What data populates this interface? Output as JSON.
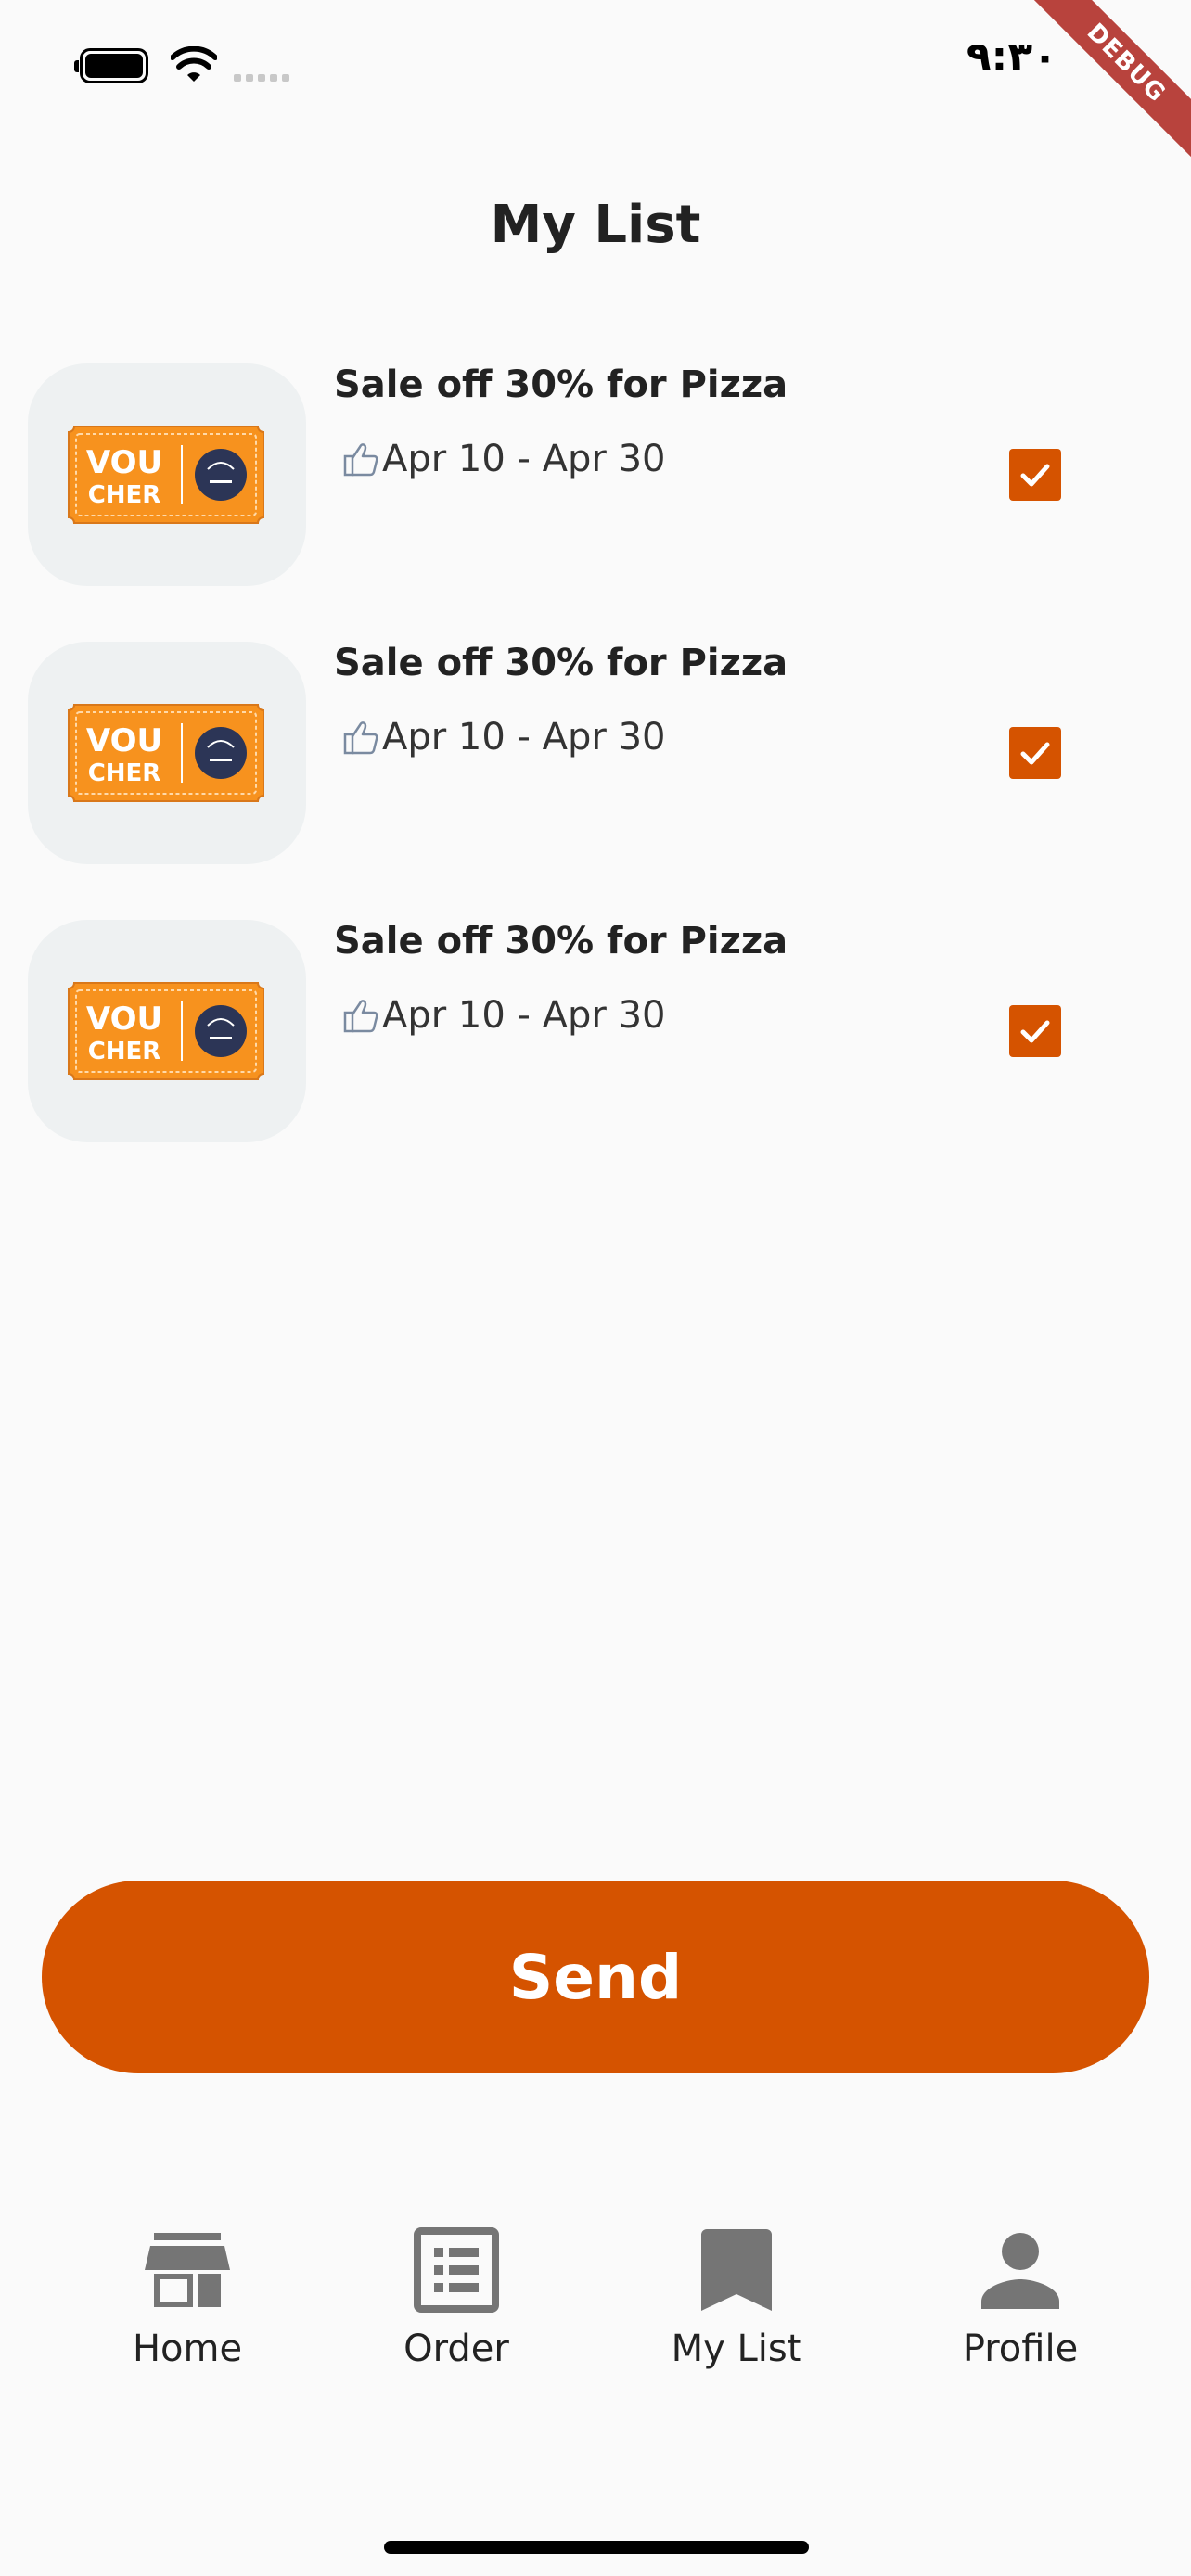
{
  "status_bar": {
    "time": "٩:٣٠",
    "debug_label": "DEBUG"
  },
  "page": {
    "title": "My List"
  },
  "vouchers": [
    {
      "title": "Sale off 30% for Pizza",
      "date": "Apr 10 - Apr 30",
      "checked": true,
      "image_text_top": "VOU",
      "image_text_bottom": "CHER"
    },
    {
      "title": "Sale off 30% for Pizza",
      "date": "Apr 10 - Apr 30",
      "checked": true,
      "image_text_top": "VOU",
      "image_text_bottom": "CHER"
    },
    {
      "title": "Sale off 30% for Pizza",
      "date": "Apr 10 - Apr 30",
      "checked": true,
      "image_text_top": "VOU",
      "image_text_bottom": "CHER"
    }
  ],
  "send_button": {
    "label": "Send"
  },
  "bottom_nav": {
    "items": [
      {
        "label": "Home",
        "icon": "store-icon"
      },
      {
        "label": "Order",
        "icon": "list-icon"
      },
      {
        "label": "My List",
        "icon": "bookmark-icon"
      },
      {
        "label": "Profile",
        "icon": "person-icon"
      }
    ]
  },
  "colors": {
    "accent": "#d55300",
    "background": "#fafafa",
    "thumb_bg": "#eef1f2",
    "nav_icon": "#757575",
    "voucher_orange": "#f7921e",
    "debug_ribbon": "#b8433d"
  }
}
